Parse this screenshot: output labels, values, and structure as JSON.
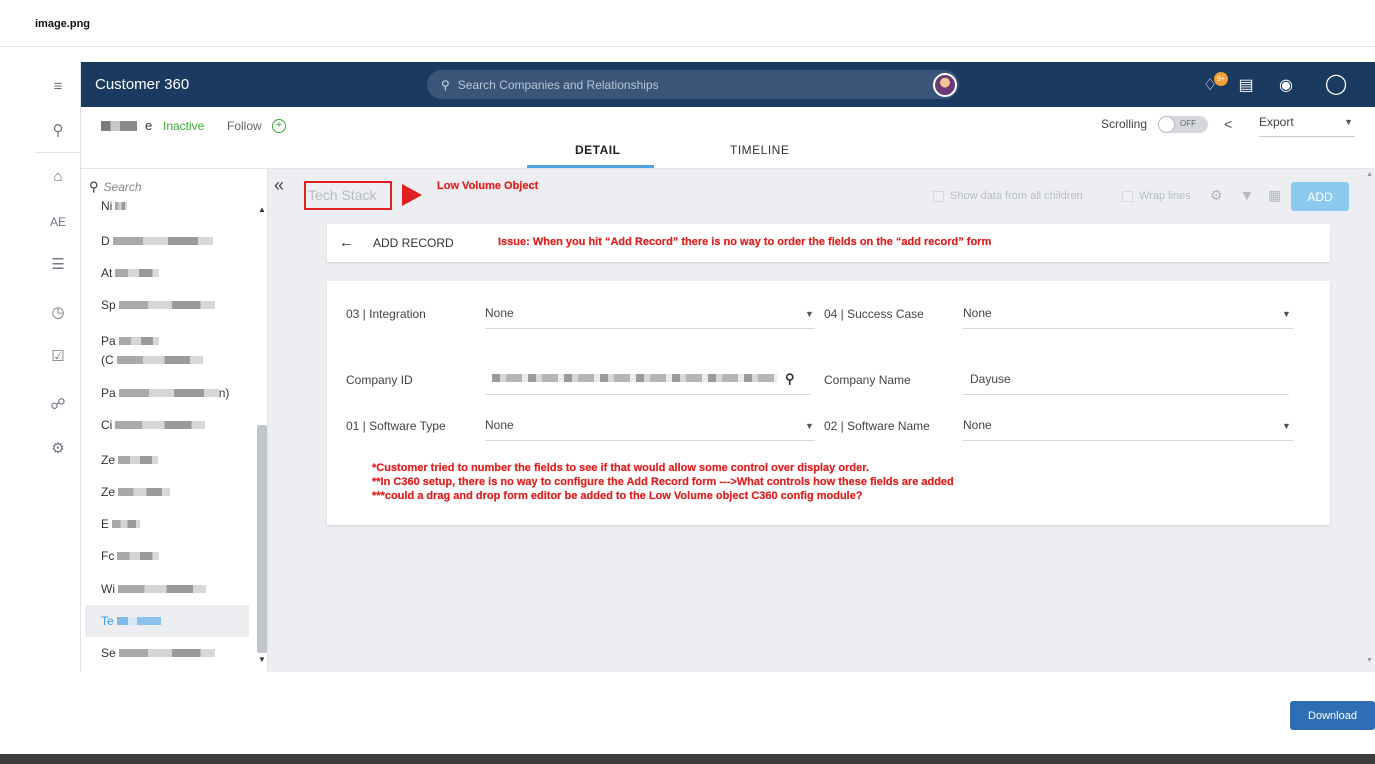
{
  "viewer": {
    "title": "image.png",
    "download_label": "Download"
  },
  "app": {
    "title": "Customer 360",
    "search_placeholder": "Search Companies and Relationships",
    "notification_badge": "9+",
    "left_nav": {
      "ae_label": "AE"
    }
  },
  "subheader": {
    "company_suffix": "e",
    "status": "Inactive",
    "follow_label": "Follow",
    "tabs": [
      {
        "label": "DETAIL"
      },
      {
        "label": "TIMELINE"
      }
    ],
    "scrolling_label": "Scrolling",
    "toggle_text": "OFF",
    "export_label": "Export"
  },
  "sidebar": {
    "search_placeholder": "Search",
    "items": [
      {
        "prefix": "Ni"
      },
      {
        "prefix": "D"
      },
      {
        "prefix": "At"
      },
      {
        "prefix": "Sp"
      },
      {
        "prefix": "Pa"
      },
      {
        "prefix": "(C"
      },
      {
        "prefix": "Pa",
        "suffix": "n)"
      },
      {
        "prefix": "Ci"
      },
      {
        "prefix": "Ze"
      },
      {
        "prefix": "Ze"
      },
      {
        "prefix": "E"
      },
      {
        "prefix": "Fc"
      },
      {
        "prefix": "Wi"
      },
      {
        "prefix": "Te"
      },
      {
        "prefix": "Se"
      }
    ]
  },
  "content": {
    "section_title": "Tech Stack",
    "show_children_label": "Show data from all children",
    "wrap_lines_label": "Wrap lines",
    "add_label": "ADD",
    "add_record_label": "ADD RECORD",
    "fields": {
      "integration": {
        "label": "03 | Integration",
        "value": "None"
      },
      "success_case": {
        "label": "04 | Success Case",
        "value": "None"
      },
      "company_id": {
        "label": "Company ID"
      },
      "company_name": {
        "label": "Company Name",
        "value": "Dayuse"
      },
      "software_type": {
        "label": "01 | Software Type",
        "value": "None"
      },
      "software_name": {
        "label": "02 | Software Name",
        "value": "None"
      }
    }
  },
  "annotations": {
    "low_volume": "Low Volume Object",
    "issue": "Issue: When you hit “Add Record” there is no way to order the fields on the “add record” form",
    "note1": "*Customer tried to number the fields to see if that would allow some control over display order.",
    "note2": "**In C360 setup, there is no way to configure the Add Record form --->What controls how these fields are added",
    "note3": "***could a drag and drop form editor be added to the Low Volume object C360 config module?"
  }
}
